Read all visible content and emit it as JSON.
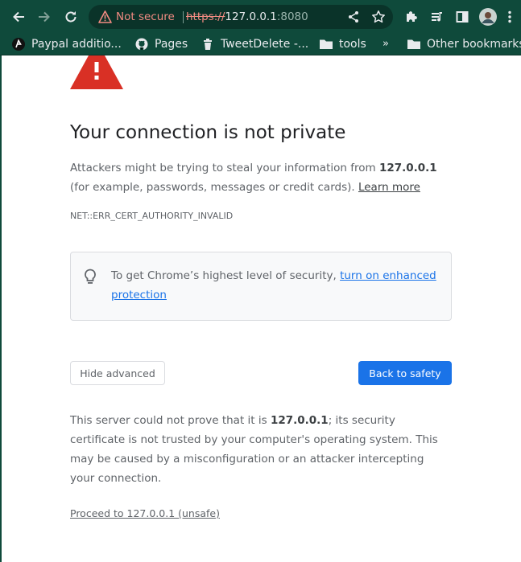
{
  "browser": {
    "security_state": "Not secure",
    "url_scheme": "https://",
    "url_host": "127.0.0.1",
    "url_port": ":8080",
    "bookmarks": [
      {
        "label": "Paypal additio...",
        "icon": "paypal-icon"
      },
      {
        "label": "Pages",
        "icon": "github-icon"
      },
      {
        "label": "TweetDelete -...",
        "icon": "trash-icon"
      },
      {
        "label": "tools",
        "icon": "folder-icon"
      }
    ],
    "overflow_label": "»",
    "other_bookmarks": "Other bookmarks"
  },
  "interstitial": {
    "heading": "Your connection is not private",
    "main_prefix": "Attackers might be trying to steal your information from ",
    "main_host": "127.0.0.1",
    "main_suffix": " (for example, passwords, messages or credit cards). ",
    "learn_more": "Learn more",
    "error_code": "NET::ERR_CERT_AUTHORITY_INVALID",
    "enhanced_prefix": "To get Chrome’s highest level of security, ",
    "enhanced_link": "turn on enhanced protection",
    "hide_advanced": "Hide advanced",
    "back_to_safety": "Back to safety",
    "details_prefix": "This server could not prove that it is ",
    "details_host": "127.0.0.1",
    "details_suffix": "; its security certificate is not trusted by your computer's operating system. This may be caused by a misconfiguration or an attacker intercepting your connection.",
    "proceed_link": "Proceed to 127.0.0.1 (unsafe)"
  },
  "colors": {
    "chrome_bg": "#0f4a3b",
    "omnibox_bg": "#0a3329",
    "warning_red": "#d93025",
    "primary_blue": "#1a73e8"
  }
}
